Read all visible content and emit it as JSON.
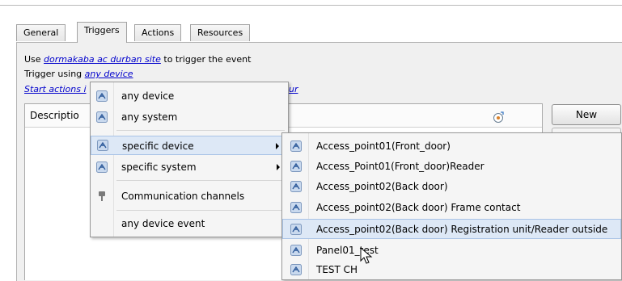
{
  "tabs": [
    "General",
    "Triggers",
    "Actions",
    "Resources"
  ],
  "info": {
    "use_prefix": "Use ",
    "use_link": "dormakaba ac durban site",
    "use_suffix": " to trigger the event",
    "trigger_prefix": "Trigger using ",
    "trigger_link": "any device",
    "start_actions_left": "Start actions i",
    "start_actions_right": "ur"
  },
  "table": {
    "column_description": "Descriptio"
  },
  "buttons": {
    "new": "New"
  },
  "menu_primary": {
    "items": [
      {
        "label": "any device",
        "icon": "device-icon"
      },
      {
        "label": "any system",
        "icon": "device-icon"
      },
      {
        "label": "specific device",
        "icon": "device-icon",
        "submenu": true,
        "highlighted": true
      },
      {
        "label": "specific system",
        "icon": "device-icon",
        "submenu": true
      },
      {
        "label": "Communication channels",
        "icon": "plug-icon"
      },
      {
        "label": "any device event",
        "icon": ""
      }
    ]
  },
  "menu_devices": {
    "items": [
      {
        "label": "Access_point01(Front_door)"
      },
      {
        "label": "Access_Point01(Front_door)Reader"
      },
      {
        "label": "Access_point02(Back door)"
      },
      {
        "label": "Access_point02(Back door) Frame contact"
      },
      {
        "label": "Access_point02(Back door) Registration unit/Reader outside",
        "highlighted": true
      },
      {
        "label": "Panel01_test"
      },
      {
        "label": "TEST CH"
      }
    ]
  },
  "colors": {
    "link": "#0000cc",
    "menu_highlight": "#dde8f6",
    "menu_highlight_border": "#a9c3e6"
  }
}
